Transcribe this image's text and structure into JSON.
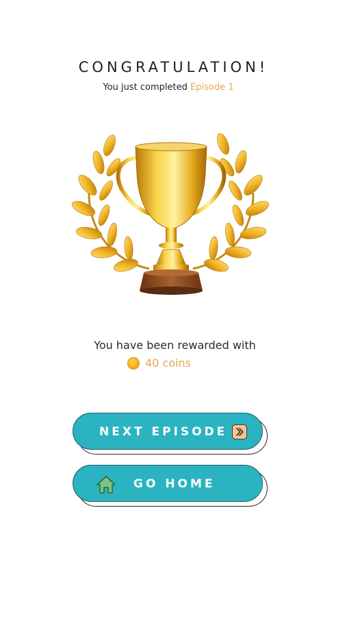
{
  "header": {
    "title": "CONGRATULATION!",
    "subtitle_prefix": "You just completed ",
    "episode_label": "Episode 1"
  },
  "trophy": {
    "icon": "trophy-with-laurel-icon"
  },
  "reward": {
    "text": "You have been rewarded with",
    "coins_label": "40 coins",
    "coin_icon": "coin-icon"
  },
  "buttons": {
    "next_label": "NEXT EPISODE",
    "next_icon": "arrow-right-icon",
    "home_label": "GO HOME",
    "home_icon": "home-icon"
  },
  "colors": {
    "button_teal": "#2bb3c1",
    "accent_orange": "#eaa44a",
    "trophy_gold": "#e8b11c",
    "trophy_base": "#8b4a22"
  }
}
